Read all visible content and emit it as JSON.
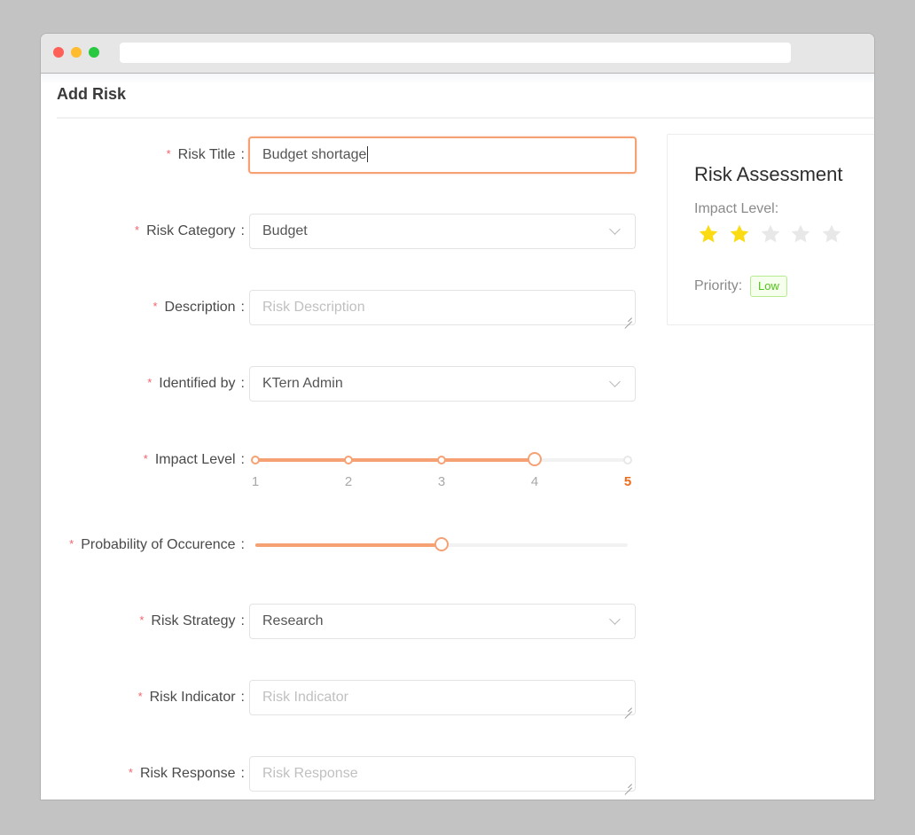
{
  "window": {
    "controls": [
      "close",
      "minimize",
      "maximize"
    ],
    "url": ""
  },
  "page": {
    "title": "Add Risk"
  },
  "form": {
    "required_marker": "*",
    "separator": ":",
    "risk_title": {
      "label": "Risk Title",
      "value": "Budget shortage",
      "focused": true
    },
    "risk_category": {
      "label": "Risk Category",
      "value": "Budget",
      "icon": "chevron-down-icon"
    },
    "description": {
      "label": "Description",
      "value": "",
      "placeholder": "Risk Description"
    },
    "identified_by": {
      "label": "Identified by",
      "value": "KTern Admin",
      "icon": "chevron-down-icon"
    },
    "impact_level": {
      "label": "Impact Level",
      "value": 4,
      "min": 1,
      "max": 5,
      "marks": [
        "1",
        "2",
        "3",
        "4",
        "5"
      ],
      "highlighted_mark": "5"
    },
    "probability": {
      "label": "Probability of Occurence",
      "value_percent": 50
    },
    "risk_strategy": {
      "label": "Risk Strategy",
      "value": "Research",
      "icon": "chevron-down-icon"
    },
    "risk_indicator": {
      "label": "Risk Indicator",
      "value": "",
      "placeholder": "Risk Indicator"
    },
    "risk_response": {
      "label": "Risk Response",
      "value": "",
      "placeholder": "Risk Response"
    }
  },
  "assessment": {
    "title": "Risk Assessment",
    "impact_label": "Impact Level:",
    "stars_filled": 2,
    "stars_total": 5,
    "star_colors": {
      "filled": "#fadb14",
      "empty": "#e8e8e8"
    },
    "priority_label": "Priority:",
    "priority_value": "Low",
    "priority_color": "#52c41a"
  },
  "colors": {
    "accent": "#f5a173",
    "accent_strong": "#f26a1b",
    "required": "#f5626b"
  }
}
